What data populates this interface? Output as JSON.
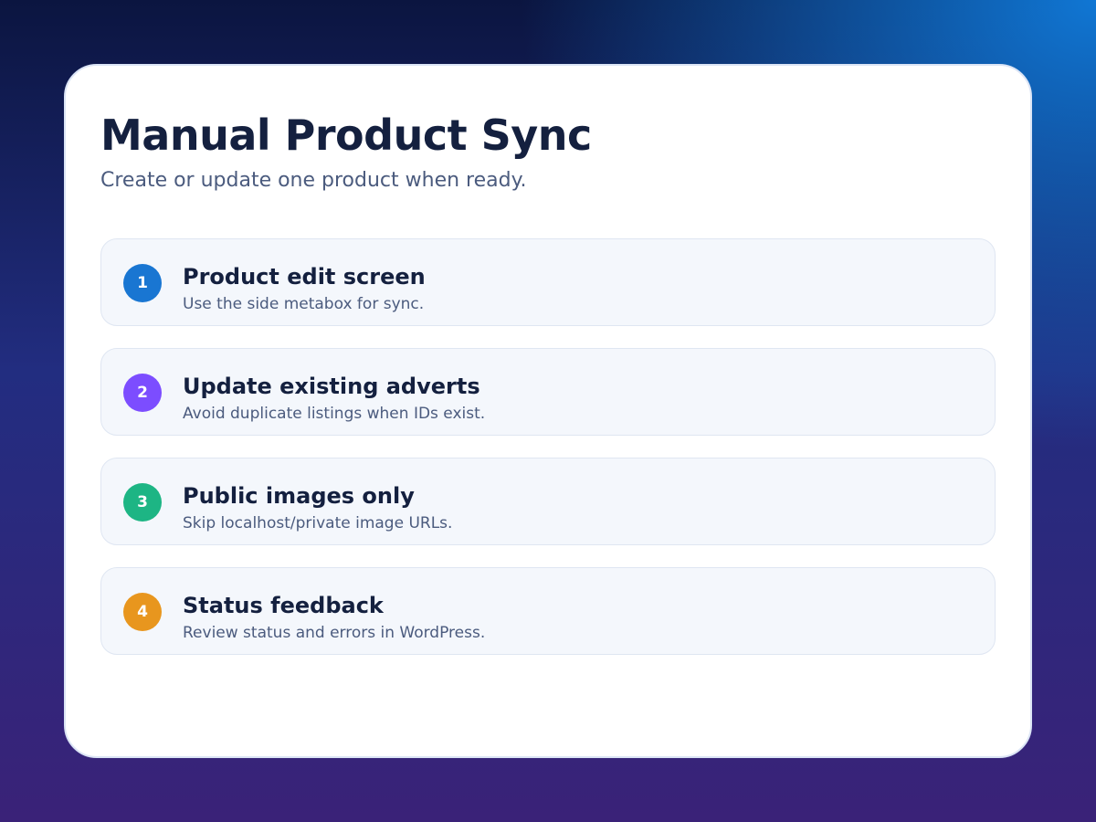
{
  "page": {
    "title": "Manual Product Sync",
    "subtitle": "Create or update one product when ready."
  },
  "steps": [
    {
      "number": "1",
      "title": "Product edit screen",
      "description": "Use the side metabox for sync.",
      "color": "#1976d2"
    },
    {
      "number": "2",
      "title": "Update existing adverts",
      "description": "Avoid duplicate listings when IDs exist.",
      "color": "#7c4dff"
    },
    {
      "number": "3",
      "title": "Public images only",
      "description": "Skip localhost/private image URLs.",
      "color": "#1db584"
    },
    {
      "number": "4",
      "title": "Status feedback",
      "description": "Review status and errors in WordPress.",
      "color": "#e8961e"
    }
  ]
}
